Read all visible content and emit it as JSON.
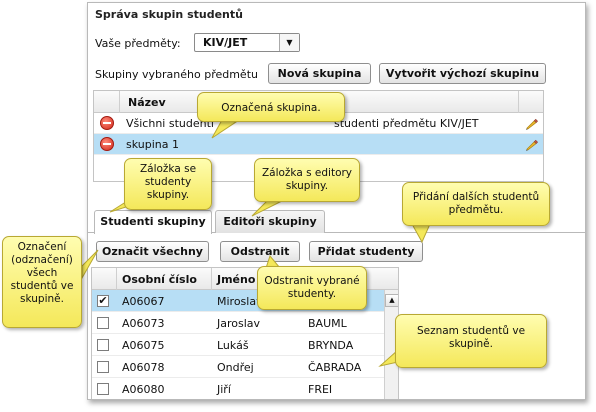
{
  "panel_title": "Správa skupin studentů",
  "subjects_label": "Vaše předměty:",
  "subject_selected": "KIV/JET",
  "groups_label": "Skupiny vybraného předmětu",
  "buttons": {
    "new_group": "Nová skupina",
    "create_default": "Vytvořit výchozí skupinu",
    "select_all": "Označit všechny",
    "remove": "Odstranit",
    "add_students": "Přidat studenty"
  },
  "groups_table": {
    "header_name": "Název",
    "rows": [
      {
        "name": "Všichni studenti",
        "desc": "studenti předmětu KIV/JET",
        "selected": false
      },
      {
        "name": "skupina 1",
        "desc": "",
        "selected": true
      }
    ]
  },
  "tabs": [
    {
      "label": "Studenti skupiny",
      "active": true
    },
    {
      "label": "Editoři skupiny",
      "active": false
    }
  ],
  "students_table": {
    "headers": [
      "Osobní číslo",
      "Jméno",
      ""
    ],
    "rows": [
      {
        "id": "A06067",
        "first": "Miroslav",
        "last": "",
        "checked": true,
        "selected": true
      },
      {
        "id": "A06073",
        "first": "Jaroslav",
        "last": "BAUML",
        "checked": false,
        "selected": false
      },
      {
        "id": "A06075",
        "first": "Lukáš",
        "last": "BRYNDA",
        "checked": false,
        "selected": false
      },
      {
        "id": "A06078",
        "first": "Ondřej",
        "last": "ČABRADA",
        "checked": false,
        "selected": false
      },
      {
        "id": "A06080",
        "first": "Jiří",
        "last": "FREI",
        "checked": false,
        "selected": false
      }
    ]
  },
  "callouts": {
    "selected_group": "Označená skupina.",
    "students_tab": "Záložka se studenty skupiny.",
    "editors_tab": "Záložka s editory skupiny.",
    "add_more": "Přidání dalších studentů předmětu.",
    "select_toggle": "Označení (odznačení) všech studentů ve skupině.",
    "remove_selected": "Odstranit vybrané studenty.",
    "students_list": "Seznam studentů ve skupině."
  },
  "colors": {
    "selection": "#b7def5",
    "callout": "#f4e85a",
    "delete_icon": "#d0281a"
  }
}
